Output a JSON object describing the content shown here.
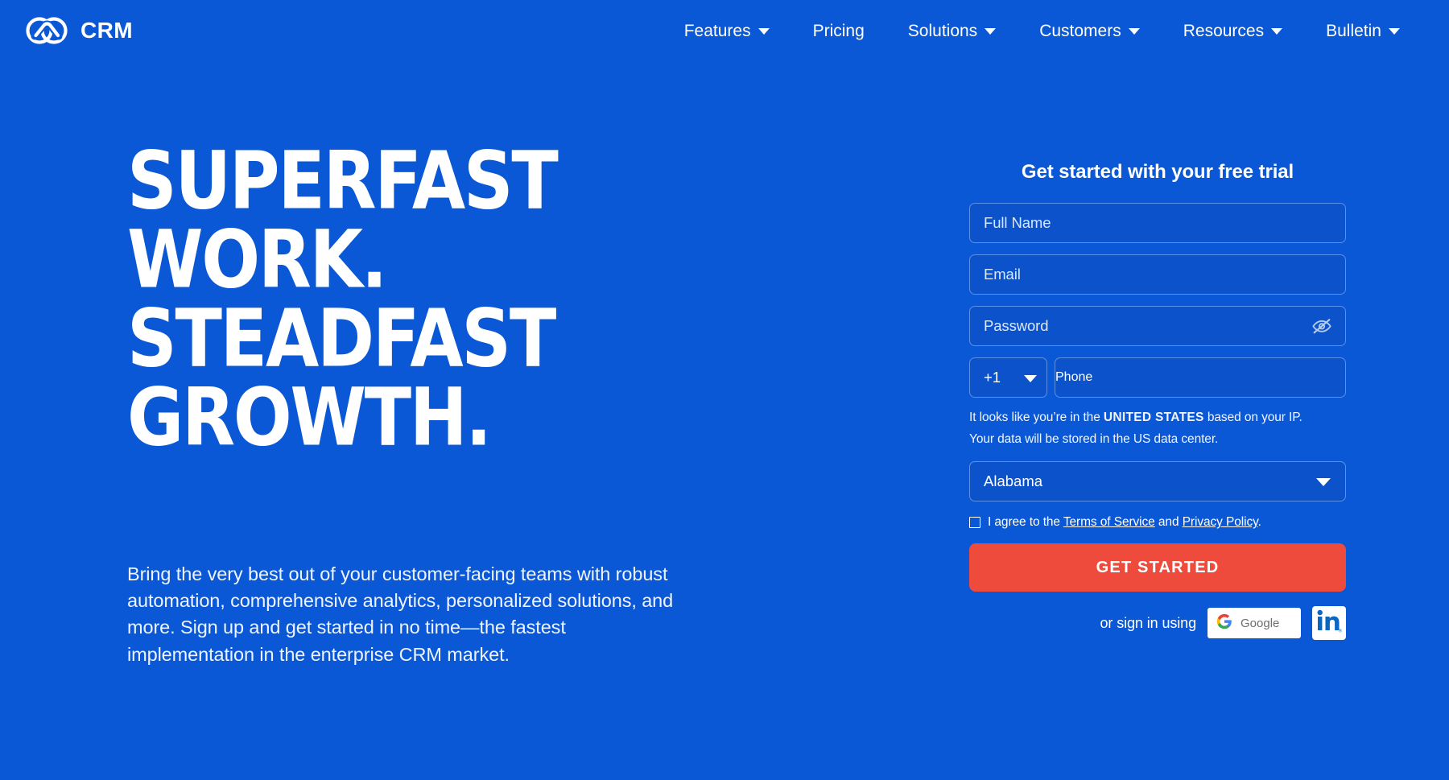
{
  "brand": {
    "name": "CRM",
    "logo_icon": "interlocking-links-logo"
  },
  "nav": {
    "items": [
      {
        "label": "Features",
        "has_dropdown": true
      },
      {
        "label": "Pricing",
        "has_dropdown": false
      },
      {
        "label": "Solutions",
        "has_dropdown": true
      },
      {
        "label": "Customers",
        "has_dropdown": true
      },
      {
        "label": "Resources",
        "has_dropdown": true
      },
      {
        "label": "Bulletin",
        "has_dropdown": true
      }
    ]
  },
  "hero": {
    "title_lines": [
      "SUPERFAST",
      "WORK.",
      "STEADFAST",
      "GROWTH."
    ],
    "description": "Bring the very best out of your customer-facing teams with robust automation, comprehensive analytics, personalized solutions, and more. Sign up and get started in no time—the fastest implementation in the enterprise CRM market."
  },
  "signup": {
    "title": "Get started with your free trial",
    "fields": {
      "full_name": {
        "placeholder": "Full Name",
        "value": ""
      },
      "email": {
        "placeholder": "Email",
        "value": ""
      },
      "password": {
        "placeholder": "Password",
        "value": "",
        "reveal_icon": "eye-off-icon"
      },
      "phone": {
        "placeholder": "Phone",
        "value": ""
      }
    },
    "country_code": {
      "value": "+1",
      "icon": "chevron-down-icon"
    },
    "ip_note_line1_prefix": "It looks like you’re in the ",
    "ip_note_country": "UNITED STATES",
    "ip_note_line1_suffix": " based on your IP.",
    "ip_note_line2": "Your data will be stored in the US data center.",
    "state": {
      "value": "Alabama",
      "icon": "chevron-down-icon"
    },
    "terms": {
      "prefix": "I agree to the ",
      "terms_link": "Terms of Service",
      "middle": " and ",
      "privacy_link": "Privacy Policy",
      "suffix": ".",
      "checked": false
    },
    "cta_label": "GET STARTED",
    "social": {
      "label": "or sign in using",
      "google_label": "Google",
      "google_icon": "google-g-icon",
      "linkedin_icon": "linkedin-in-icon"
    }
  },
  "colors": {
    "page_bg": "#0a58d6",
    "field_bg": "#0c53cb",
    "field_border": "#5b91e6",
    "cta_bg": "#ee4b3c",
    "text": "#ffffff"
  }
}
